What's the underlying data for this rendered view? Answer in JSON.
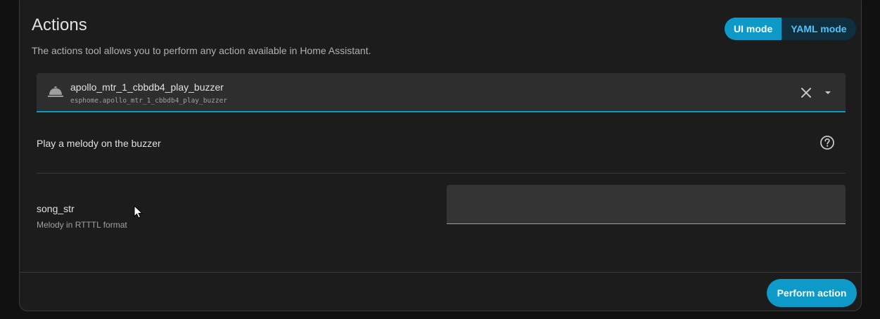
{
  "header": {
    "title": "Actions",
    "subtitle": "The actions tool allows you to perform any action available in Home Assistant."
  },
  "mode_toggle": {
    "ui_label": "UI mode",
    "yaml_label": "YAML mode",
    "selected": "UI mode"
  },
  "action_picker": {
    "icon": "bell-icon",
    "name": "apollo_mtr_1_cbbdb4_play_buzzer",
    "id": "esphome.apollo_mtr_1_cbbdb4_play_buzzer"
  },
  "action_description": "Play a melody on the buzzer",
  "fields": [
    {
      "name": "song_str",
      "description": "Melody in RTTTL format",
      "value": ""
    }
  ],
  "footer": {
    "perform_label": "Perform action"
  },
  "colors": {
    "accent": "#0d9ac9",
    "accent_dark": "#0f2f3f",
    "accent_text": "#4fc3f7",
    "card_bg": "#1c1c1c",
    "page_bg": "#111111"
  }
}
